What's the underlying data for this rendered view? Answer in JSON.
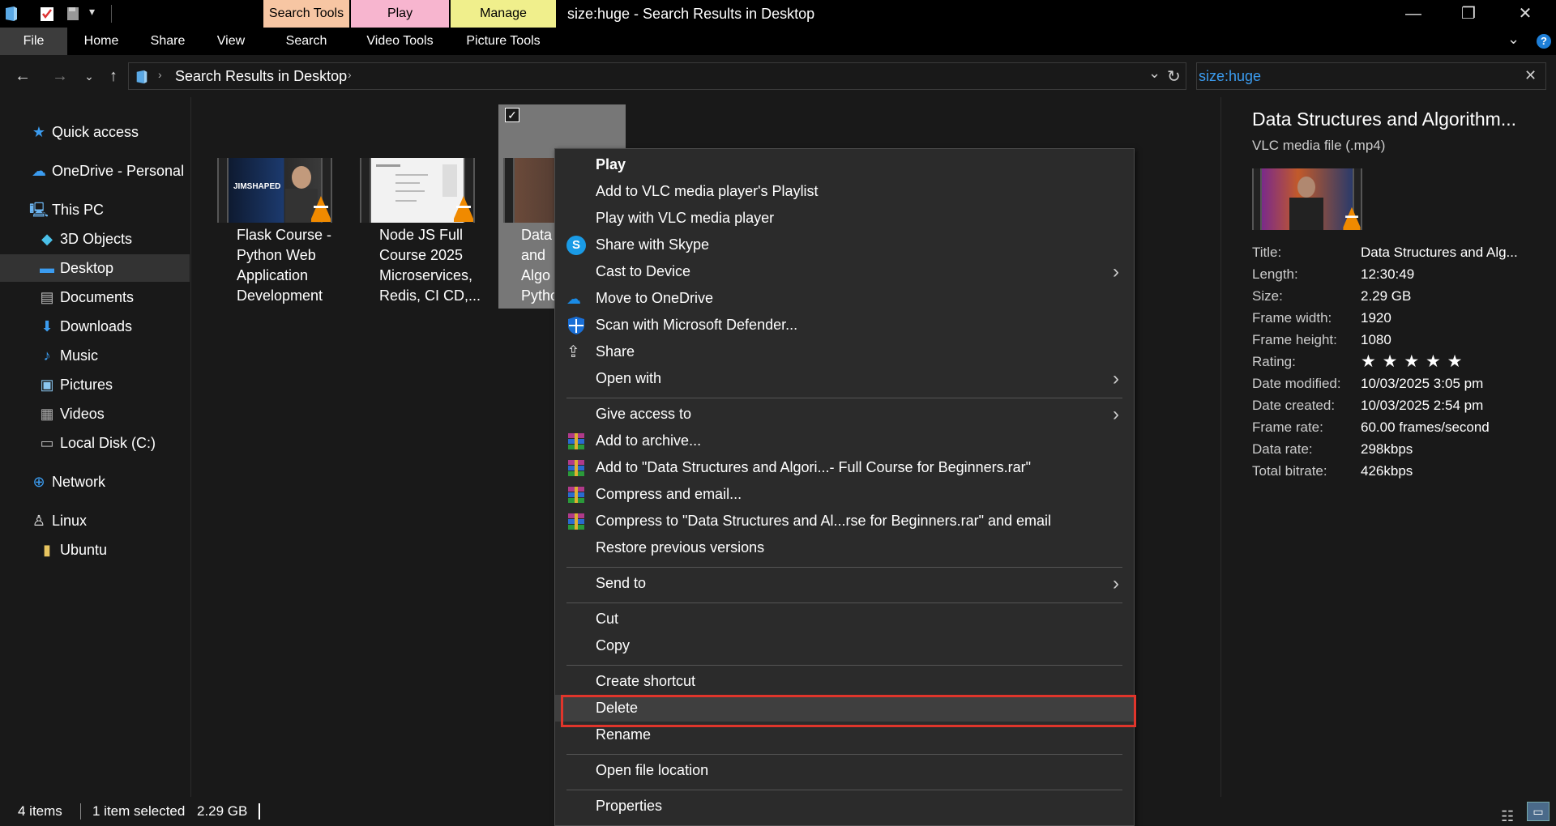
{
  "window": {
    "title": "size:huge - Search Results in Desktop",
    "minimize_icon": "minimize-icon",
    "maximize_icon": "restore-icon",
    "close_icon": "close-icon"
  },
  "context_tabs": [
    {
      "label": "Search Tools",
      "color": "#f7c6a3",
      "sub": "Search"
    },
    {
      "label": "Play",
      "color": "#f7b5cf",
      "sub": "Video Tools"
    },
    {
      "label": "Manage",
      "color": "#f0ef8c",
      "sub": "Picture Tools"
    }
  ],
  "ribbon_tabs": [
    "File",
    "Home",
    "Share",
    "View"
  ],
  "address": {
    "path": "Search Results in Desktop",
    "search_value": "size:huge"
  },
  "nav": {
    "items": [
      {
        "label": "Quick access",
        "icon": "star-icon"
      },
      {
        "label": "OneDrive - Personal",
        "icon": "cloud-icon"
      },
      {
        "label": "This PC",
        "icon": "computer-icon"
      },
      {
        "label": "3D Objects",
        "icon": "cube-icon"
      },
      {
        "label": "Desktop",
        "icon": "desktop-icon"
      },
      {
        "label": "Documents",
        "icon": "document-icon"
      },
      {
        "label": "Downloads",
        "icon": "download-icon"
      },
      {
        "label": "Music",
        "icon": "music-icon"
      },
      {
        "label": "Pictures",
        "icon": "picture-icon"
      },
      {
        "label": "Videos",
        "icon": "video-icon"
      },
      {
        "label": "Local Disk (C:)",
        "icon": "disk-icon"
      },
      {
        "label": "Network",
        "icon": "network-icon"
      },
      {
        "label": "Linux",
        "icon": "linux-icon"
      },
      {
        "label": "Ubuntu",
        "icon": "folder-icon"
      }
    ]
  },
  "files": [
    {
      "name_lines": [
        "Flask Course -",
        "Python Web",
        "Application",
        "Development"
      ]
    },
    {
      "name_lines": [
        "Node JS Full",
        "Course 2025",
        "Microservices,",
        "Redis, CI CD,..."
      ]
    },
    {
      "name_lines": [
        "Data",
        "and",
        "Algo",
        "Pytho"
      ]
    }
  ],
  "thumb_text": {
    "flask": "JIMSHAPED"
  },
  "context_menu": {
    "items": [
      {
        "label": "Play",
        "icon": ""
      },
      {
        "label": "Add to VLC media player's Playlist",
        "icon": ""
      },
      {
        "label": "Play with VLC media player",
        "icon": ""
      },
      {
        "label": "Share with Skype",
        "icon": "skype-icon"
      },
      {
        "label": "Cast to Device",
        "icon": ""
      },
      {
        "label": "Move to OneDrive",
        "icon": "onedrive-icon"
      },
      {
        "label": "Scan with Microsoft Defender...",
        "icon": "defender-icon"
      },
      {
        "label": "Share",
        "icon": "share-icon"
      },
      {
        "label": "Open with",
        "icon": ""
      },
      {
        "label": "Give access to",
        "icon": ""
      },
      {
        "label": "Add to archive...",
        "icon": "winrar-icon"
      },
      {
        "label": "Add to \"Data Structures and Algori...- Full Course for Beginners.rar\"",
        "icon": "winrar-icon"
      },
      {
        "label": "Compress and email...",
        "icon": "winrar-icon"
      },
      {
        "label": "Compress to \"Data Structures and Al...rse for Beginners.rar\" and email",
        "icon": "winrar-icon"
      },
      {
        "label": "Restore previous versions",
        "icon": ""
      },
      {
        "label": "Send to",
        "icon": ""
      },
      {
        "label": "Cut",
        "icon": ""
      },
      {
        "label": "Copy",
        "icon": ""
      },
      {
        "label": "Create shortcut",
        "icon": ""
      },
      {
        "label": "Delete",
        "icon": ""
      },
      {
        "label": "Rename",
        "icon": ""
      },
      {
        "label": "Open file location",
        "icon": ""
      },
      {
        "label": "Properties",
        "icon": ""
      }
    ]
  },
  "preview": {
    "title": "Data Structures and Algorithm...",
    "type": "VLC media file (.mp4)",
    "props": [
      {
        "label": "Title:",
        "value": "Data Structures and Alg..."
      },
      {
        "label": "Length:",
        "value": "12:30:49"
      },
      {
        "label": "Size:",
        "value": "2.29 GB"
      },
      {
        "label": "Frame width:",
        "value": "1920"
      },
      {
        "label": "Frame height:",
        "value": "1080"
      },
      {
        "label": "Rating:",
        "value": "★ ★ ★ ★ ★"
      },
      {
        "label": "Date modified:",
        "value": "10/03/2025 3:05 pm"
      },
      {
        "label": "Date created:",
        "value": "10/03/2025 2:54 pm"
      },
      {
        "label": "Frame rate:",
        "value": "60.00 frames/second"
      },
      {
        "label": "Data rate:",
        "value": "298kbps"
      },
      {
        "label": "Total bitrate:",
        "value": "426kbps"
      }
    ]
  },
  "status": {
    "count": "4 items",
    "selected": "1 item selected",
    "size": "2.29 GB"
  },
  "colors": {
    "accent": "#1e90ff",
    "delete_highlight": "#e0352b"
  }
}
